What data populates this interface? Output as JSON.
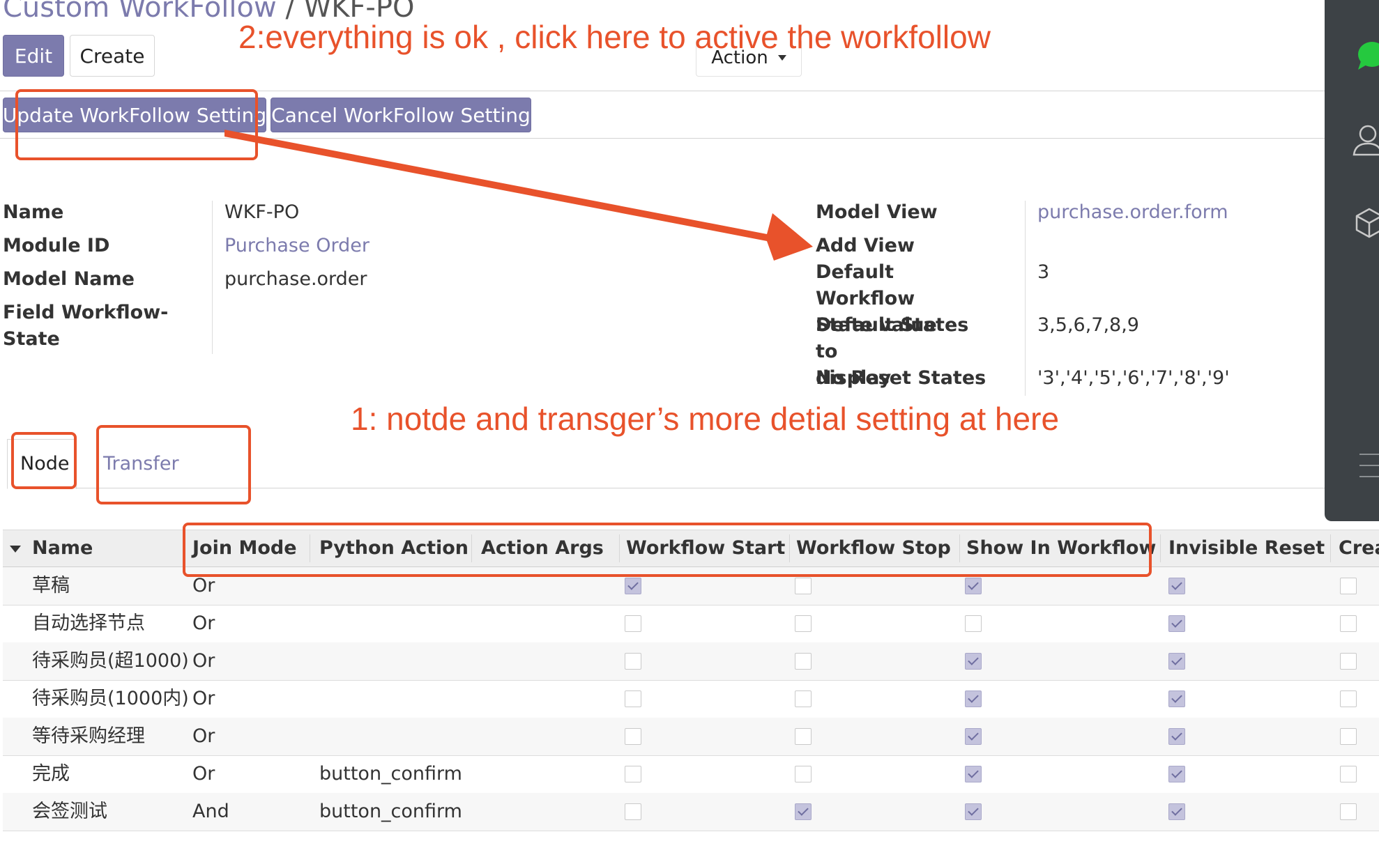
{
  "breadcrumb": {
    "parent": "Custom WorkFollow",
    "separator": "/",
    "current": "WKF-PO"
  },
  "toolbar": {
    "edit": "Edit",
    "create": "Create",
    "action": "Action"
  },
  "workflow_buttons": {
    "update": "Update WorkFollow Setting",
    "cancel": "Cancel WorkFollow Setting"
  },
  "annotations": {
    "step2": "2:everything is ok , click here to active the workfollow",
    "step1": "1: notde and transger’s more detial  setting at here"
  },
  "form": {
    "left": [
      {
        "label": "Name",
        "value": "WKF-PO",
        "link": false
      },
      {
        "label": "Module ID",
        "value": "Purchase Order",
        "link": true
      },
      {
        "label": "Model Name",
        "value": "purchase.order",
        "link": false
      },
      {
        "label": "Field Workflow-\nState",
        "value": "",
        "link": false
      }
    ],
    "right": [
      {
        "label": "Model View",
        "value": "purchase.order.form",
        "link": true
      },
      {
        "label": "Add View",
        "value": "",
        "link": false
      },
      {
        "label": "Default Workflow\nState value",
        "value": "3",
        "link": false
      },
      {
        "label": "Default States to\ndisplay",
        "value": "3,5,6,7,8,9",
        "link": false
      },
      {
        "label": "No Reset States",
        "value": "'3','4','5','6','7','8','9'",
        "link": false
      }
    ]
  },
  "tabs": [
    {
      "label": "Node",
      "active": true
    },
    {
      "label": "Transfer",
      "active": false
    }
  ],
  "table": {
    "columns": [
      "Name",
      "Join Mode",
      "Python Action",
      "Action Args",
      "Workflow Start",
      "Workflow Stop",
      "Show In Workflow",
      "Invisible Reset",
      "Crea"
    ],
    "rows": [
      {
        "name": "草稿",
        "join_mode": "Or",
        "python_action": "",
        "action_args": "",
        "workflow_start": true,
        "workflow_stop": false,
        "show_in_workflow": true,
        "invisible_reset": true,
        "crea": false
      },
      {
        "name": "自动选择节点",
        "join_mode": "Or",
        "python_action": "",
        "action_args": "",
        "workflow_start": false,
        "workflow_stop": false,
        "show_in_workflow": false,
        "invisible_reset": true,
        "crea": false
      },
      {
        "name": "待采购员(超1000)",
        "join_mode": "Or",
        "python_action": "",
        "action_args": "",
        "workflow_start": false,
        "workflow_stop": false,
        "show_in_workflow": true,
        "invisible_reset": true,
        "crea": false
      },
      {
        "name": "待采购员(1000内)",
        "join_mode": "Or",
        "python_action": "",
        "action_args": "",
        "workflow_start": false,
        "workflow_stop": false,
        "show_in_workflow": true,
        "invisible_reset": true,
        "crea": false
      },
      {
        "name": "等待采购经理",
        "join_mode": "Or",
        "python_action": "",
        "action_args": "",
        "workflow_start": false,
        "workflow_stop": false,
        "show_in_workflow": true,
        "invisible_reset": true,
        "crea": false
      },
      {
        "name": "完成",
        "join_mode": "Or",
        "python_action": "button_confirm",
        "action_args": "",
        "workflow_start": false,
        "workflow_stop": false,
        "show_in_workflow": true,
        "invisible_reset": true,
        "crea": false
      },
      {
        "name": "会签测试",
        "join_mode": "And",
        "python_action": "button_confirm",
        "action_args": "",
        "workflow_start": false,
        "workflow_stop": true,
        "show_in_workflow": true,
        "invisible_reset": true,
        "crea": false
      }
    ]
  },
  "side_icons": [
    "chat-bubble-icon",
    "user-icon",
    "cube-icon",
    "menu-icon"
  ],
  "colors": {
    "primary": "#7c7bad",
    "annotation": "#e8522b",
    "side_panel": "#3d4246"
  }
}
